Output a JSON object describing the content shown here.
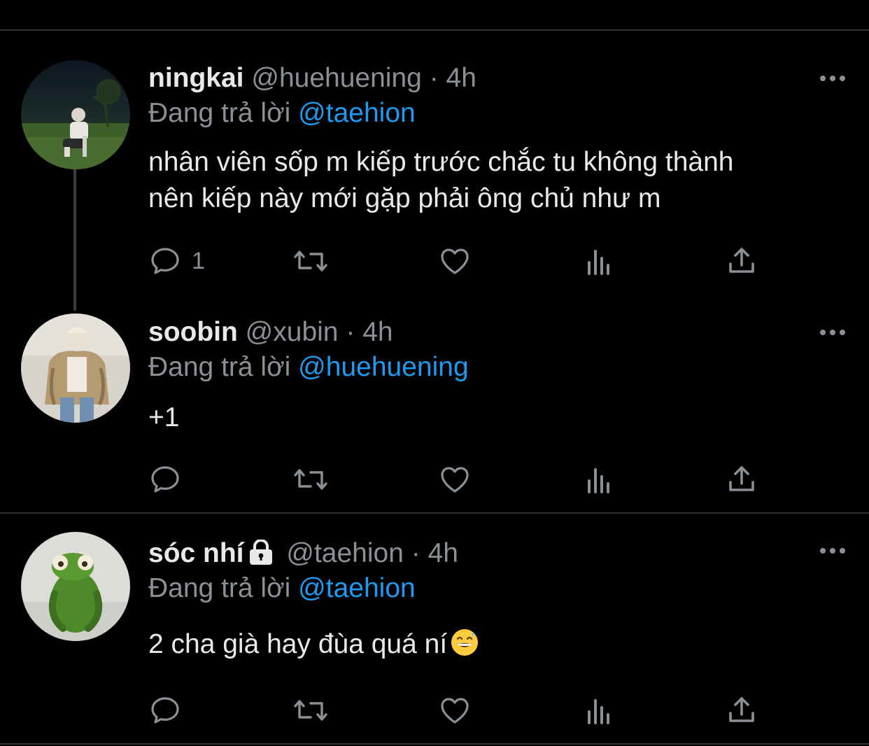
{
  "colors": {
    "background": "#000000",
    "text": "#e7e9ea",
    "muted": "#8b9096",
    "mention": "#1d9bf0",
    "divider": "#2f3336"
  },
  "tweets": [
    {
      "display_name": "ningkai",
      "handle": "@huehuening",
      "separator": "·",
      "time": "4h",
      "replying_prefix": "Đang trả lời",
      "replying_to": "@taehion",
      "text_lines": [
        "nhân viên sốp m kiếp trước chắc tu không thành",
        "nên kiếp này mới gặp phải ông chủ như m"
      ],
      "reply_count": "1",
      "avatar": "photo-person-on-grass-night",
      "icons": [
        "reply-icon",
        "retweet-icon",
        "like-icon",
        "analytics-icon",
        "share-icon",
        "more-icon"
      ]
    },
    {
      "display_name": "soobin",
      "handle": "@xubin",
      "separator": "·",
      "time": "4h",
      "replying_prefix": "Đang trả lời",
      "replying_to": "@huehuening",
      "text_lines": [
        "+1"
      ],
      "reply_count": "",
      "avatar": "photo-person-in-jacket",
      "icons": [
        "reply-icon",
        "retweet-icon",
        "like-icon",
        "analytics-icon",
        "share-icon",
        "more-icon"
      ]
    },
    {
      "display_name": "sóc nhí",
      "protected_icon": "lock-icon",
      "handle": "@taehion",
      "separator": "·",
      "time": "4h",
      "replying_prefix": "Đang trả lời",
      "replying_to": "@taehion",
      "text_lines": [
        "2 cha già hay đùa quá ní"
      ],
      "text_emoji": "grinning-face-with-sweat-emoji",
      "reply_count": "",
      "avatar": "photo-green-plush-frog",
      "icons": [
        "reply-icon",
        "retweet-icon",
        "like-icon",
        "analytics-icon",
        "share-icon",
        "more-icon"
      ]
    }
  ]
}
